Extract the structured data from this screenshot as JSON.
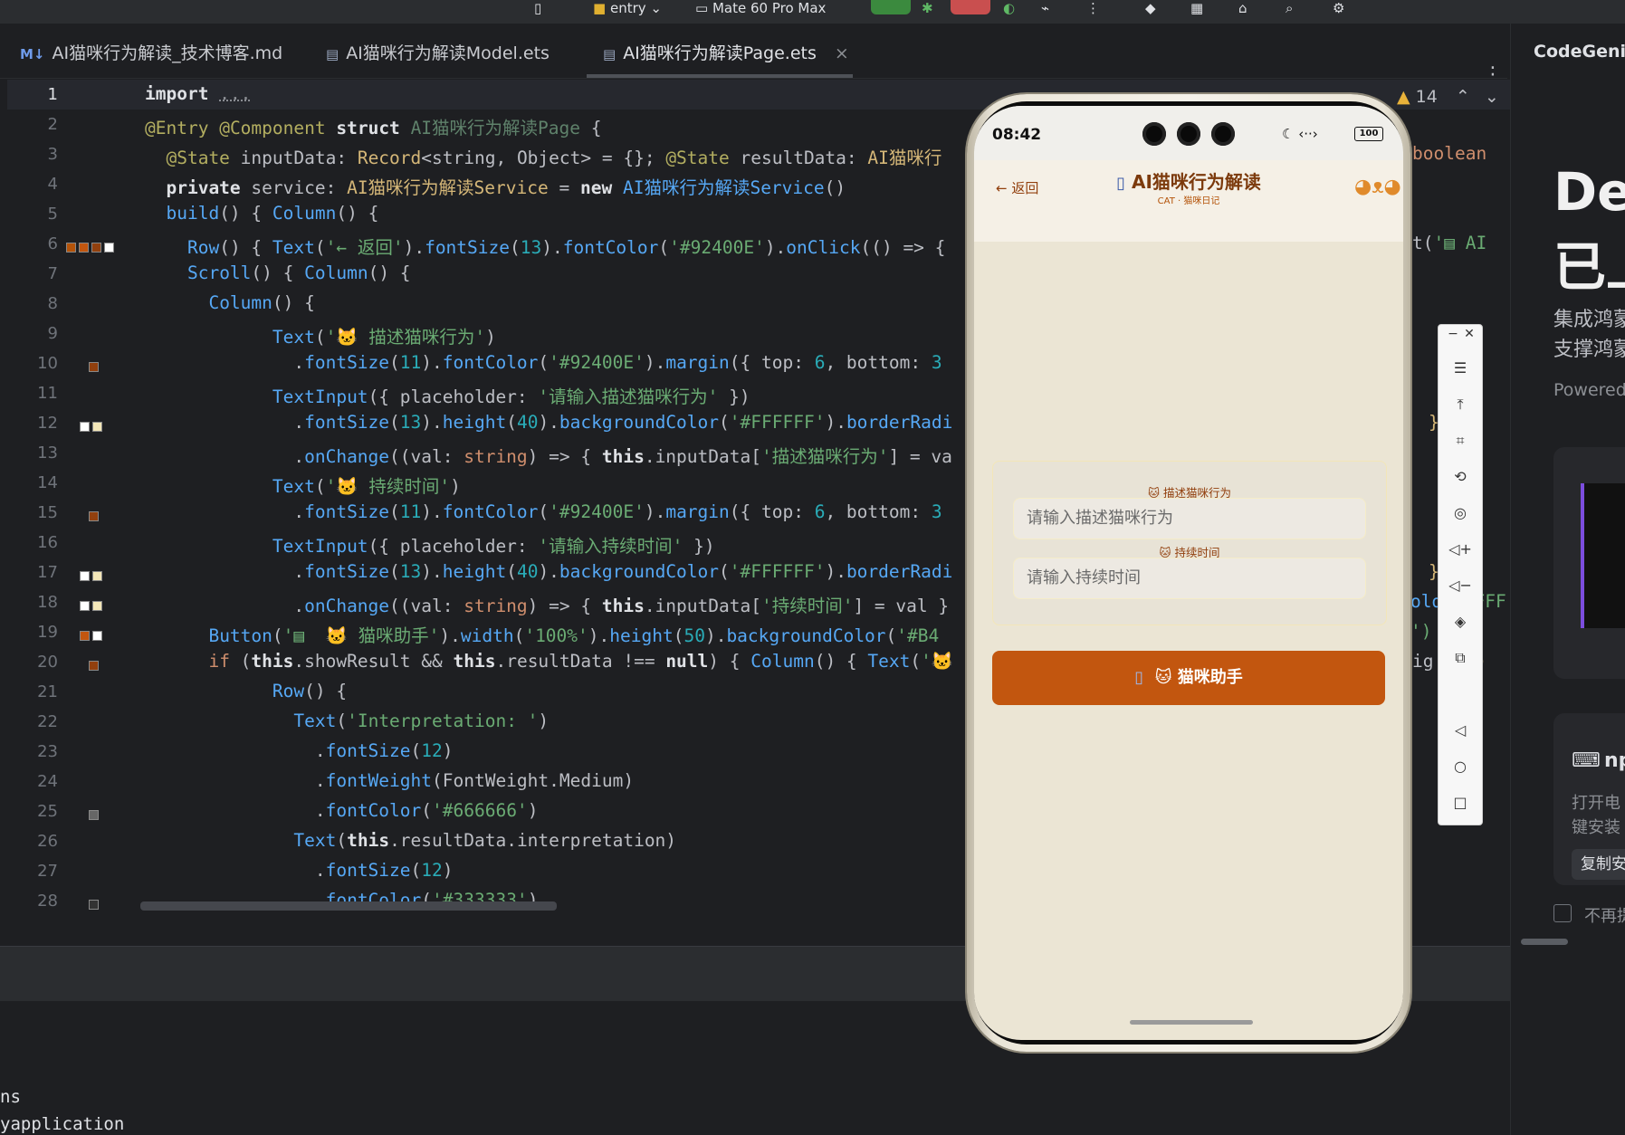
{
  "topbar": {
    "run_config": "entry",
    "device": "Mate 60 Pro Max"
  },
  "tabs": [
    {
      "label": "AI猫咪行为解读_技术博客.md",
      "icon": "M↓"
    },
    {
      "label": "AI猫咪行为解读Model.ets",
      "icon": "▤"
    },
    {
      "label": "AI猫咪行为解读Page.ets",
      "icon": "▤",
      "close": "×"
    }
  ],
  "editor": {
    "problems_count": "14",
    "line_numbers": [
      "1",
      "2",
      "3",
      "4",
      "5",
      "6",
      "7",
      "8",
      "9",
      "10",
      "11",
      "12",
      "13",
      "14",
      "15",
      "16",
      "17",
      "18",
      "19",
      "20",
      "21",
      "22",
      "23",
      "24",
      "25",
      "26",
      "27",
      "28"
    ]
  },
  "phone": {
    "time": "08:42",
    "battery": "100",
    "back_label": "← 返回",
    "title": "AI猫咪行为解读",
    "subtitle": "CAT · 猫咪日记",
    "field1_label": "🐱 描述猫咪行为",
    "field1_placeholder": "请输入描述猫咪行为",
    "field2_label": "🐱 持续时间",
    "field2_placeholder": "请输入持续时间",
    "button_label": "🐱 猫咪助手"
  },
  "codegenie": {
    "title": "CodeGenie",
    "big_text_1": "Dev",
    "big_text_2": "已上",
    "desc_1": "集成鸿蒙",
    "desc_2": "支撑鸿蒙",
    "powered": "Powered",
    "np_label": "np",
    "open_1": "打开电",
    "open_2": "键安装",
    "copy_btn": "复制安",
    "no_more": "不再提"
  },
  "terminal": {
    "line1": "ns",
    "line2": "yapplication"
  },
  "colors": {
    "accent_orange": "#c2560f",
    "label_brown": "#92400e"
  }
}
